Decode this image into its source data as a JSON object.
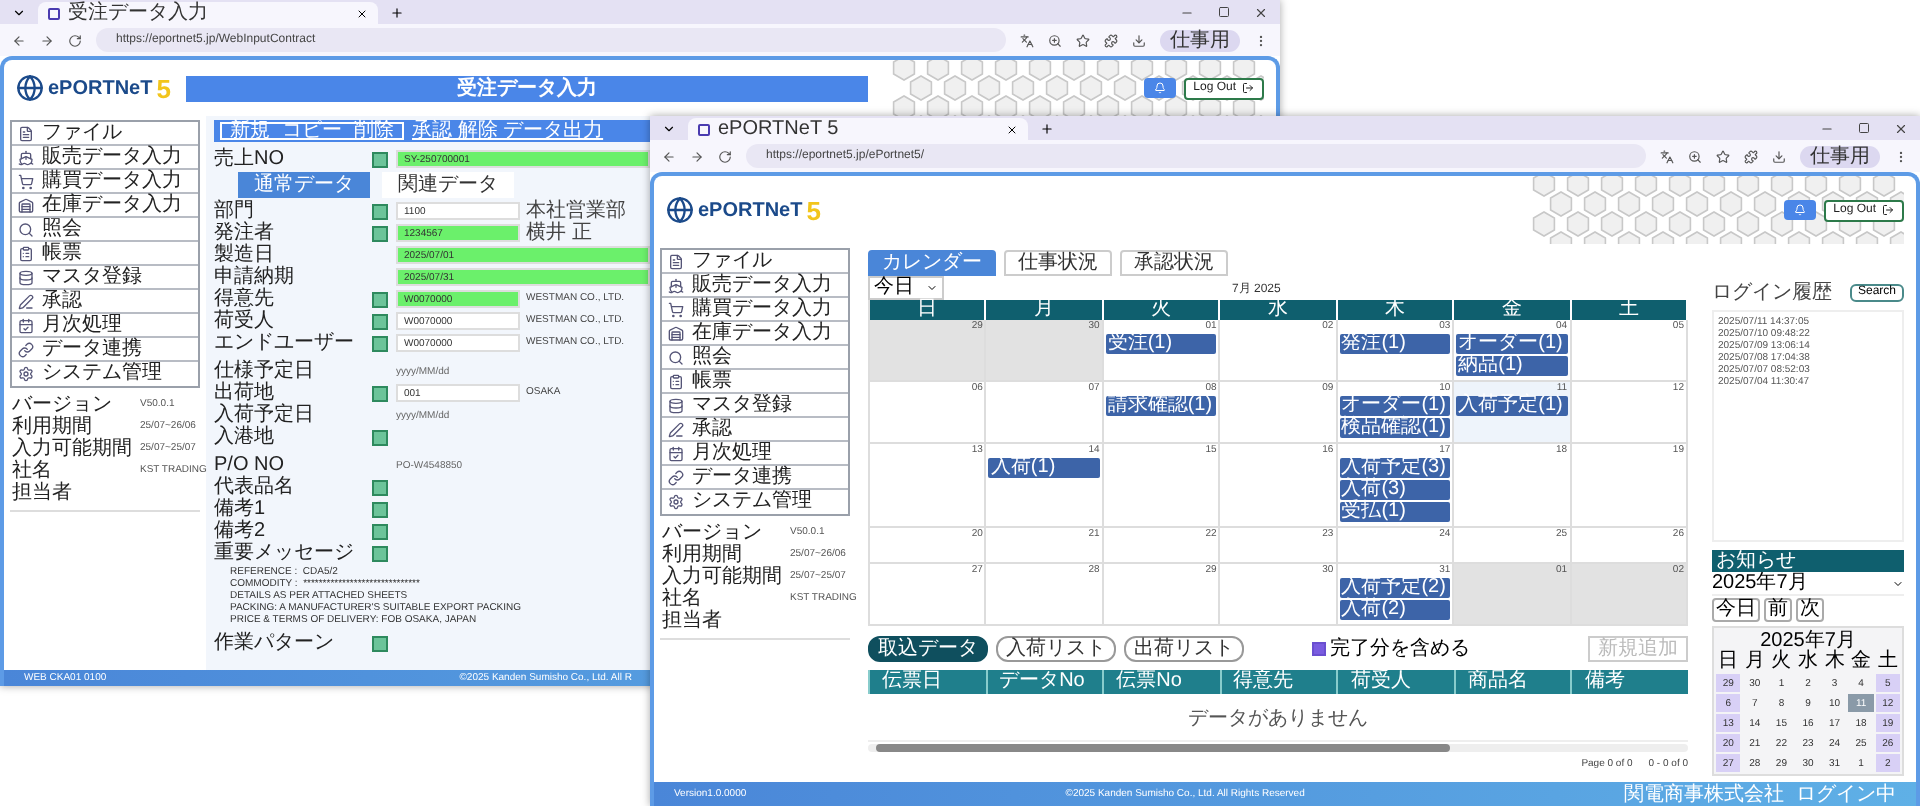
{
  "back_window": {
    "tab_title": "受注データ入力",
    "url": "https://eportnet5.jp/WebInputContract",
    "profile": "仕事用",
    "logo": "ePORTNeT",
    "logo_mark": "5",
    "header_title": "受注データ入力",
    "logout": "Log Out",
    "sidebar": [
      "ファイル",
      "販売データ入力",
      "購買データ入力",
      "在庫データ入力",
      "照会",
      "帳票",
      "マスタ登録",
      "承認",
      "月次処理",
      "データ連携",
      "システム管理"
    ],
    "info": [
      {
        "label": "バージョン",
        "value": "V50.0.1"
      },
      {
        "label": "利用期間",
        "value": "25/07~26/06"
      },
      {
        "label": "入力可能期間",
        "value": "25/07~25/07"
      },
      {
        "label": "社名",
        "value": "KST TRADING"
      },
      {
        "label": "担当者"
      }
    ],
    "toolbar": {
      "chips": [
        "新規",
        "コピー",
        "削除"
      ],
      "link": "承認 解除 データ出力"
    },
    "order_no": {
      "label": "売上NO",
      "value": "SY-250700001",
      "green": true
    },
    "form_tabs": [
      {
        "label": "通常データ",
        "selected": true
      },
      {
        "label": "関連データ",
        "selected": false
      }
    ],
    "rows": [
      {
        "label": "部門",
        "kind": "field",
        "value": "1100",
        "extra": "本社営業部",
        "green": false
      },
      {
        "label": "発注者",
        "kind": "field",
        "value": "1234567",
        "extra": "横井 正",
        "green": true
      },
      {
        "label": "製造日",
        "kind": "date",
        "value": "2025/07/01",
        "green": true
      },
      {
        "label": "申請納期",
        "kind": "date",
        "value": "2025/07/31",
        "green": true
      },
      {
        "label": "得意先",
        "kind": "field",
        "value": "W0070000",
        "extra": "WESTMAN CO., LTD.",
        "green": true
      },
      {
        "label": "荷受人",
        "kind": "field",
        "value": "W0070000",
        "extra": "WESTMAN CO., LTD.",
        "green": false
      },
      {
        "label": "エンドユーザー",
        "kind": "field",
        "value": "W0070000",
        "extra": "WESTMAN CO., LTD.",
        "green": false
      },
      {
        "label": "仕様予定日",
        "kind": "text",
        "value": "yyyy/MM/dd"
      },
      {
        "label": "出荷地",
        "kind": "field",
        "value": "001",
        "extra": "OSAKA",
        "green": false
      },
      {
        "label": "入荷予定日",
        "kind": "text",
        "value": "yyyy/MM/dd"
      },
      {
        "label": "入港地",
        "kind": "check"
      },
      {
        "label": "P/O NO",
        "kind": "text",
        "value": "PO-W4548850"
      },
      {
        "label": "代表品名",
        "kind": "check"
      },
      {
        "label": "備考1",
        "kind": "check"
      },
      {
        "label": "備考2",
        "kind": "check"
      }
    ],
    "message": {
      "label": "重要メッセージ",
      "lines": [
        "REFERENCE :  CDA5/2",
        "COMMODITY :  ******************************",
        "DETAILS AS PER ATTACHED SHEETS",
        "PACKING: A MANUFACTURER'S SUITABLE EXPORT PACKING",
        "PRICE & TERMS OF DELIVERY: FOB OSAKA, JAPAN"
      ]
    },
    "work_pattern": "作業パターン",
    "footer": [
      "WEB CKA01 0100",
      "©2025 Kanden Sumisho Co., Ltd. All R"
    ]
  },
  "front_window": {
    "tab_title": "ePORTNeT 5",
    "url": "https://eportnet5.jp/ePortnet5/",
    "profile": "仕事用",
    "logo": "ePORTNeT",
    "logo_mark": "5",
    "logout": "Log Out",
    "sidebar": [
      "ファイル",
      "販売データ入力",
      "購買データ入力",
      "在庫データ入力",
      "照会",
      "帳票",
      "マスタ登録",
      "承認",
      "月次処理",
      "データ連携",
      "システム管理"
    ],
    "info": [
      {
        "label": "バージョン",
        "value": "V50.0.1"
      },
      {
        "label": "利用期間",
        "value": "25/07~26/06"
      },
      {
        "label": "入力可能期間",
        "value": "25/07~25/07"
      },
      {
        "label": "社名",
        "value": "KST TRADING"
      },
      {
        "label": "担当者"
      }
    ],
    "view_tabs": [
      {
        "label": "カレンダー",
        "selected": true
      },
      {
        "label": "仕事状況",
        "selected": false
      },
      {
        "label": "承認状況",
        "selected": false
      }
    ],
    "today_select": "今日",
    "month_title": "7月 2025",
    "weekdays": [
      "日",
      "月",
      "火",
      "水",
      "木",
      "金",
      "土"
    ],
    "weeks": [
      [
        {
          "date": "29",
          "other": true,
          "today": false
        },
        {
          "date": "30",
          "other": true,
          "today": false
        },
        {
          "date": "01",
          "other": false,
          "today": false,
          "events": [
            "受注(1)"
          ]
        },
        {
          "date": "02",
          "other": false,
          "today": false
        },
        {
          "date": "03",
          "other": false,
          "today": false,
          "events": [
            "発注(1)"
          ]
        },
        {
          "date": "04",
          "other": false,
          "today": false,
          "events": [
            "オーダー(1)",
            "納品(1)"
          ]
        },
        {
          "date": "05",
          "other": false,
          "today": false
        }
      ],
      [
        {
          "date": "06",
          "other": false,
          "today": false
        },
        {
          "date": "07",
          "other": false,
          "today": false
        },
        {
          "date": "08",
          "other": false,
          "today": false,
          "events": [
            "請求確認(1)"
          ]
        },
        {
          "date": "09",
          "other": false,
          "today": false
        },
        {
          "date": "10",
          "other": false,
          "today": false,
          "events": [
            "オーダー(1)",
            "検品確認(1)"
          ]
        },
        {
          "date": "11",
          "other": false,
          "today": true,
          "events": [
            "入荷予定(1)"
          ]
        },
        {
          "date": "12",
          "other": false,
          "today": false
        }
      ],
      [
        {
          "date": "13",
          "other": false,
          "today": false
        },
        {
          "date": "14",
          "other": false,
          "today": false,
          "events": [
            "入荷(1)"
          ]
        },
        {
          "date": "15",
          "other": false,
          "today": false
        },
        {
          "date": "16",
          "other": false,
          "today": false
        },
        {
          "date": "17",
          "other": false,
          "today": false,
          "events": [
            "入荷予定(3)",
            "入荷(3)",
            "受払(1)"
          ]
        },
        {
          "date": "18",
          "other": false,
          "today": false
        },
        {
          "date": "19",
          "other": false,
          "today": false
        }
      ],
      [
        {
          "date": "20",
          "other": false,
          "today": false
        },
        {
          "date": "21",
          "other": false,
          "today": false
        },
        {
          "date": "22",
          "other": false,
          "today": false
        },
        {
          "date": "23",
          "other": false,
          "today": false
        },
        {
          "date": "24",
          "other": false,
          "today": false
        },
        {
          "date": "25",
          "other": false,
          "today": false
        },
        {
          "date": "26",
          "other": false,
          "today": false
        }
      ],
      [
        {
          "date": "27",
          "other": false,
          "today": false
        },
        {
          "date": "28",
          "other": false,
          "today": false
        },
        {
          "date": "29",
          "other": false,
          "today": false
        },
        {
          "date": "30",
          "other": false,
          "today": false
        },
        {
          "date": "31",
          "other": false,
          "today": false,
          "events": [
            "入荷予定(2)",
            "入荷(2)"
          ]
        },
        {
          "date": "01",
          "other": true,
          "today": false
        },
        {
          "date": "02",
          "other": true,
          "today": false
        }
      ]
    ],
    "actions": [
      "取込データ",
      "入荷リスト",
      "出荷リスト"
    ],
    "include_done": {
      "label": "完了分を含める",
      "checked": true
    },
    "add_button": {
      "label": "新規追加",
      "disabled": true
    },
    "columns": [
      "伝票日",
      "データNo",
      "伝票No",
      "得意先",
      "荷受人",
      "商品名",
      "備考"
    ],
    "empty_message": "データがありません",
    "pager": {
      "page": "Page 0 of 0",
      "count": "0 - 0 of 0"
    },
    "login_history": {
      "title": "ログイン履歴",
      "button": "Search",
      "entries": [
        "2025/07/11 14:37:05",
        "2025/07/10 09:48:22",
        "2025/07/09 13:06:14",
        "2025/07/08 17:04:38",
        "2025/07/07 08:52:03",
        "2025/07/04 11:30:47"
      ]
    },
    "notice": {
      "title": "お知らせ",
      "month": "2025年7月",
      "nav": [
        "今日",
        "前",
        "次"
      ]
    },
    "mini_calendar": {
      "title": "2025年7月",
      "weekdays": [
        "日",
        "月",
        "火",
        "水",
        "木",
        "金",
        "土"
      ],
      "weeks": [
        [
          {
            "d": "29",
            "selected": false
          },
          {
            "d": "30",
            "selected": false
          },
          {
            "d": "1",
            "selected": false
          },
          {
            "d": "2",
            "selected": false
          },
          {
            "d": "3",
            "selected": false
          },
          {
            "d": "4",
            "selected": false
          },
          {
            "d": "5",
            "selected": false
          }
        ],
        [
          {
            "d": "6",
            "selected": false
          },
          {
            "d": "7",
            "selected": false
          },
          {
            "d": "8",
            "selected": false
          },
          {
            "d": "9",
            "selected": false
          },
          {
            "d": "10",
            "selected": false
          },
          {
            "d": "11",
            "selected": true
          },
          {
            "d": "12",
            "selected": false
          }
        ],
        [
          {
            "d": "13",
            "selected": false
          },
          {
            "d": "14",
            "selected": false
          },
          {
            "d": "15",
            "selected": false
          },
          {
            "d": "16",
            "selected": false
          },
          {
            "d": "17",
            "selected": false
          },
          {
            "d": "18",
            "selected": false
          },
          {
            "d": "19",
            "selected": false
          }
        ],
        [
          {
            "d": "20",
            "selected": false
          },
          {
            "d": "21",
            "selected": false
          },
          {
            "d": "22",
            "selected": false
          },
          {
            "d": "23",
            "selected": false
          },
          {
            "d": "24",
            "selected": false
          },
          {
            "d": "25",
            "selected": false
          },
          {
            "d": "26",
            "selected": false
          }
        ],
        [
          {
            "d": "27",
            "selected": false
          },
          {
            "d": "28",
            "selected": false
          },
          {
            "d": "29",
            "selected": false
          },
          {
            "d": "30",
            "selected": false
          },
          {
            "d": "31",
            "selected": false
          },
          {
            "d": "1",
            "selected": false
          },
          {
            "d": "2",
            "selected": false
          }
        ]
      ]
    },
    "footer": [
      "Version1.0.0000",
      "©2025 Kanden Sumisho Co., Ltd. All Rights Reserved",
      "関電商事株式会社",
      "ログイン中"
    ]
  }
}
